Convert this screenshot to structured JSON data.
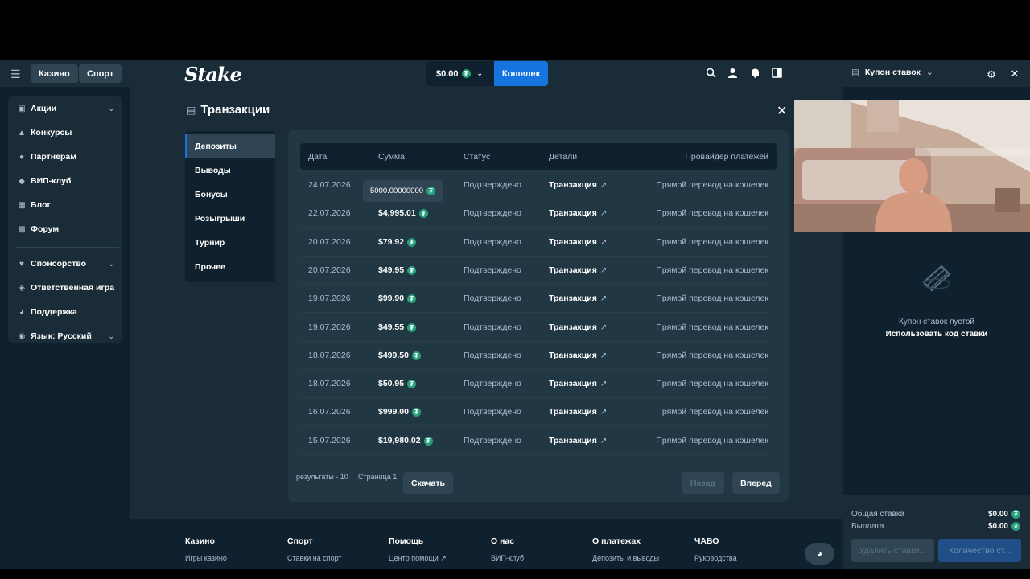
{
  "topbar": {
    "menu_icon": "hamburger-icon",
    "casino_label": "Казино",
    "sport_label": "Спорт",
    "logo": "Stake",
    "balance": "$0.00",
    "wallet_label": "Кошелек",
    "icons": [
      "search-icon",
      "user-icon",
      "bell-icon",
      "sidebar-toggle-icon"
    ]
  },
  "sidebar": {
    "group1": [
      {
        "label": "Акции",
        "icon": "gift-icon",
        "expandable": true
      },
      {
        "label": "Конкурсы",
        "icon": "trophy-icon"
      },
      {
        "label": "Партнерам",
        "icon": "people-icon"
      },
      {
        "label": "ВИП-клуб",
        "icon": "cup-icon"
      },
      {
        "label": "Блог",
        "icon": "blog-icon"
      },
      {
        "label": "Форум",
        "icon": "chat-icon"
      }
    ],
    "group2": [
      {
        "label": "Спонсорство",
        "icon": "handshake-icon",
        "expandable": true
      },
      {
        "label": "Ответственная игра",
        "icon": "shield-icon"
      },
      {
        "label": "Поддержка",
        "icon": "headset-icon"
      },
      {
        "label": "Язык: Русский",
        "icon": "globe-icon",
        "expandable": true
      }
    ]
  },
  "modal": {
    "title": "Транзакции",
    "tabs": [
      "Депозиты",
      "Выводы",
      "Бонусы",
      "Розыгрыши",
      "Турнир",
      "Прочее"
    ],
    "active_tab": "Депозиты",
    "columns": [
      "Дата",
      "Сумма",
      "Статус",
      "Детали",
      "Провайдер платежей"
    ],
    "rows": [
      {
        "date": "24.07.2026",
        "amount": "$5,000.00",
        "status": "Подтверждено",
        "details": "Транзакция",
        "provider": "Прямой перевод на кошелек"
      },
      {
        "date": "22.07.2026",
        "amount": "$4,995.01",
        "status": "Подтверждено",
        "details": "Транзакция",
        "provider": "Прямой перевод на кошелек"
      },
      {
        "date": "20.07.2026",
        "amount": "$79.92",
        "status": "Подтверждено",
        "details": "Транзакция",
        "provider": "Прямой перевод на кошелек"
      },
      {
        "date": "20.07.2026",
        "amount": "$49.95",
        "status": "Подтверждено",
        "details": "Транзакция",
        "provider": "Прямой перевод на кошелек"
      },
      {
        "date": "19.07.2026",
        "amount": "$99.90",
        "status": "Подтверждено",
        "details": "Транзакция",
        "provider": "Прямой перевод на кошелек"
      },
      {
        "date": "19.07.2026",
        "amount": "$49.55",
        "status": "Подтверждено",
        "details": "Транзакция",
        "provider": "Прямой перевод на кошелек"
      },
      {
        "date": "18.07.2026",
        "amount": "$499.50",
        "status": "Подтверждено",
        "details": "Транзакция",
        "provider": "Прямой перевод на кошелек"
      },
      {
        "date": "18.07.2026",
        "amount": "$50.95",
        "status": "Подтверждено",
        "details": "Транзакция",
        "provider": "Прямой перевод на кошелек"
      },
      {
        "date": "16.07.2026",
        "amount": "$999.00",
        "status": "Подтверждено",
        "details": "Транзакция",
        "provider": "Прямой перевод на кошелек"
      },
      {
        "date": "15.07.2026",
        "amount": "$19,980.02",
        "status": "Подтверждено",
        "details": "Транзакция",
        "provider": "Прямой перевод на кошелек"
      }
    ],
    "tooltip": "5000.00000000",
    "results_label": "результаты - 10",
    "page_label": "Страница 1",
    "download_label": "Скачать",
    "back_label": "Назад",
    "next_label": "Вперед"
  },
  "footer": {
    "columns": [
      {
        "heading": "Казино",
        "link": "Игры казино"
      },
      {
        "heading": "Спорт",
        "link": "Ставки на спорт"
      },
      {
        "heading": "Помощь",
        "link": "Центр помощи"
      },
      {
        "heading": "О нас",
        "link": "ВИП-клуб"
      },
      {
        "heading": "О платежах",
        "link": "Депозиты и выводы"
      },
      {
        "heading": "ЧАВО",
        "link": "Руководства"
      }
    ]
  },
  "betslip": {
    "title": "Купон ставок",
    "empty_title": "Купон ставок пустой",
    "empty_action": "Использовать код ставки",
    "total_stake_label": "Общая ставка",
    "total_stake_value": "$0.00",
    "payout_label": "Выплата",
    "payout_value": "$0.00",
    "clear_label": "Удалить ставки...",
    "count_label": "Количество ст..."
  },
  "colors": {
    "background": "#0f212e",
    "surface": "#1a2c38",
    "panel": "#213743",
    "accent": "#1475e1",
    "tether": "#26a17b"
  }
}
